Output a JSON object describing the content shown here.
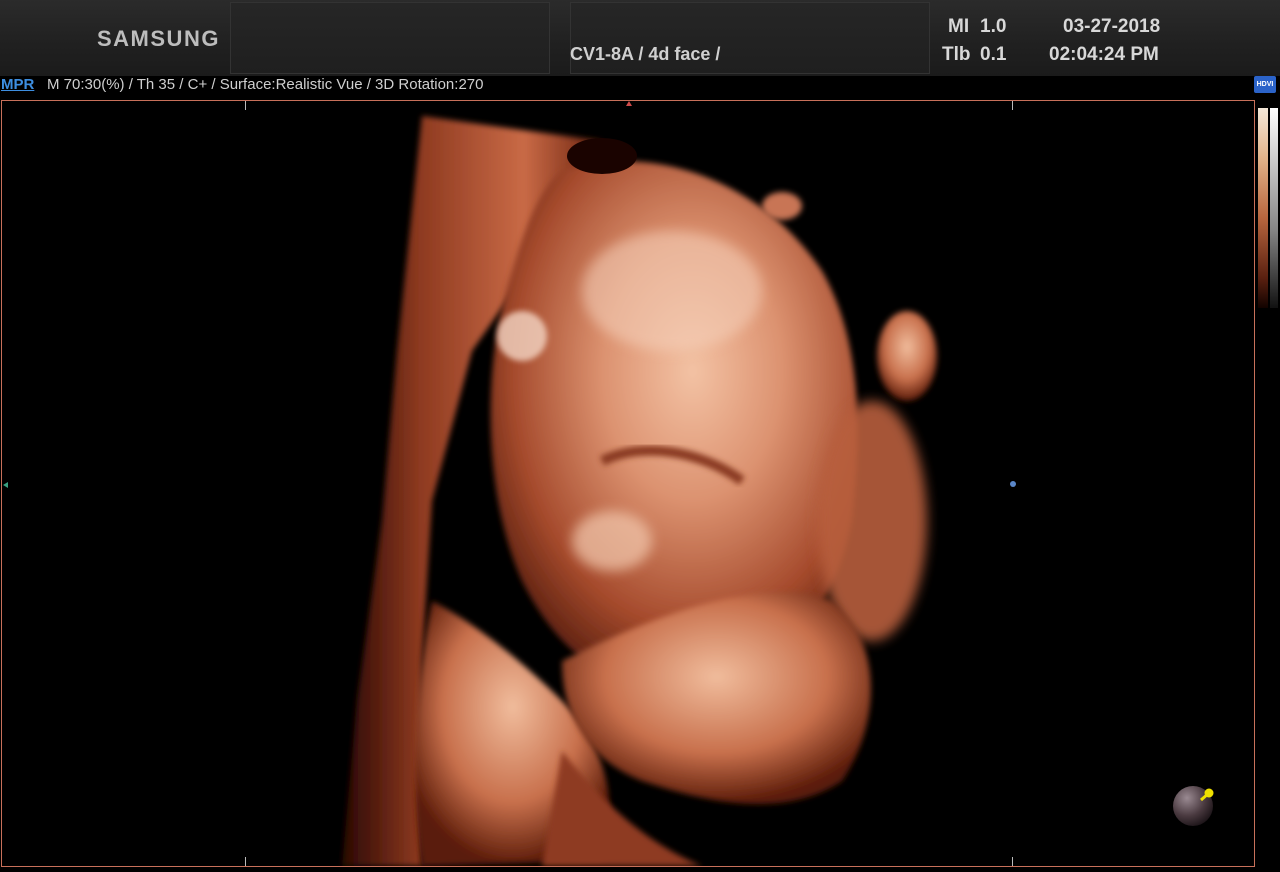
{
  "header": {
    "brand": "SAMSUNG",
    "probe_preset": "CV1-8A / 4d face /",
    "mi_label": "MI",
    "mi_value": "1.0",
    "tib_label": "Tlb",
    "tib_value": "0.1",
    "date": "03-27-2018",
    "time": "02:04:24 PM"
  },
  "info_bar": {
    "mode_tab": "MPR",
    "parameters": "M 70:30(%) / Th 35 / C+ / Surface:Realistic Vue / 3D Rotation:270",
    "hdvi_badge": "HDVI"
  },
  "colors": {
    "mode_tab": "#3d8ee0",
    "frame_border": "#c8705a",
    "render_tone": "#c46a48",
    "orientation_marker": "#f0e000"
  },
  "icons": {
    "orientation": "orientation-sphere-icon",
    "top_marker": "triangle-up-marker-icon",
    "left_marker": "triangle-left-marker-icon",
    "center_marker": "dot-marker-icon"
  }
}
